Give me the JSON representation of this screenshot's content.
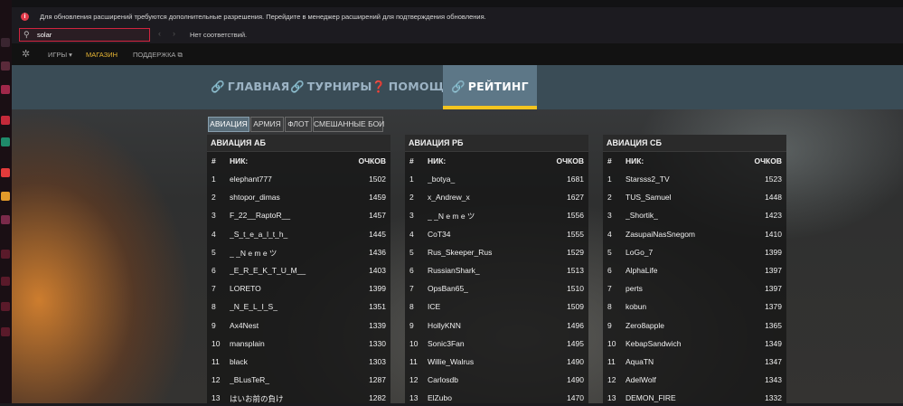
{
  "find": {
    "notice": "Для обновления расширений требуются дополнительные разрешения. Перейдите в менеджер расширений для подтверждения обновления.",
    "notice_icon": "info-icon",
    "query": "solar",
    "status": "Нет соответствий."
  },
  "topnav": {
    "games_label": "ИГРЫ ▾",
    "store_label": "МАГАЗИН",
    "support_label": "ПОДДЕРЖКА ⧉"
  },
  "menu": {
    "items": [
      {
        "label": "ГЛАВНАЯ",
        "icon": "link-icon"
      },
      {
        "label": "ТУРНИРЫ",
        "icon": "link-icon"
      },
      {
        "label": "ПОМОЩЬ",
        "icon": "question-circle-icon"
      },
      {
        "label": "РЕЙТИНГ",
        "icon": "link-icon"
      }
    ],
    "active_index": 3
  },
  "tabs": [
    "АВИАЦИЯ",
    "АРМИЯ",
    "ФЛОТ",
    "СМЕШАННЫЕ БОИ"
  ],
  "colors": {
    "accent": "#f3c51f",
    "header": "#3a4c56",
    "active": "#5d7787",
    "alert": "#d1243f"
  },
  "tables": [
    {
      "title": "АВИАЦИЯ АБ",
      "headers": [
        "#",
        "НИК:",
        "ОЧКОВ"
      ],
      "rows": [
        [
          "1",
          "elephant777",
          "1502"
        ],
        [
          "2",
          "shtopor_dimas",
          "1459"
        ],
        [
          "3",
          "F_22__RaptoR__",
          "1457"
        ],
        [
          "4",
          "_S_t_e_a_l_t_h_",
          "1445"
        ],
        [
          "5",
          "_ _N e m e ツ",
          "1436"
        ],
        [
          "6",
          "_E_R_E_K_T_U_M__",
          "1403"
        ],
        [
          "7",
          "LORETO",
          "1399"
        ],
        [
          "8",
          "_N_E_L_I_S_",
          "1351"
        ],
        [
          "9",
          "Ax4Nest",
          "1339"
        ],
        [
          "10",
          "mansplain",
          "1330"
        ],
        [
          "11",
          "black",
          "1303"
        ],
        [
          "12",
          "_BLusTeR_",
          "1287"
        ],
        [
          "13",
          "はいお前の負け",
          "1282"
        ]
      ]
    },
    {
      "title": "АВИАЦИЯ РБ",
      "headers": [
        "#",
        "НИК:",
        "ОЧКОВ"
      ],
      "rows": [
        [
          "1",
          "_botya_",
          "1681"
        ],
        [
          "2",
          "x_Andrew_x",
          "1627"
        ],
        [
          "3",
          "_ _N e m e ツ",
          "1556"
        ],
        [
          "4",
          "CoT34",
          "1555"
        ],
        [
          "5",
          "Rus_Skeeper_Rus",
          "1529"
        ],
        [
          "6",
          "RussianShark_",
          "1513"
        ],
        [
          "7",
          "OpsBan65_",
          "1510"
        ],
        [
          "8",
          "ICE",
          "1509"
        ],
        [
          "9",
          "HollyKNN",
          "1496"
        ],
        [
          "10",
          "Sonic3Fan",
          "1495"
        ],
        [
          "11",
          "Willie_Walrus",
          "1490"
        ],
        [
          "12",
          "Carlosdb",
          "1490"
        ],
        [
          "13",
          "ElZubo",
          "1470"
        ]
      ]
    },
    {
      "title": "АВИАЦИЯ СБ",
      "headers": [
        "#",
        "НИК:",
        "ОЧКОВ"
      ],
      "rows": [
        [
          "1",
          "Starsss2_TV",
          "1523"
        ],
        [
          "2",
          "TUS_Samuel",
          "1448"
        ],
        [
          "3",
          "_Shortik_",
          "1423"
        ],
        [
          "4",
          "ZasupaiNasSnegom",
          "1410"
        ],
        [
          "5",
          "LoGo_7",
          "1399"
        ],
        [
          "6",
          "AlphaLife",
          "1397"
        ],
        [
          "7",
          "perts",
          "1397"
        ],
        [
          "8",
          "kobun",
          "1379"
        ],
        [
          "9",
          "Zero8apple",
          "1365"
        ],
        [
          "10",
          "KebapSandwich",
          "1349"
        ],
        [
          "11",
          "AquaTN",
          "1347"
        ],
        [
          "12",
          "AdelWolf",
          "1343"
        ],
        [
          "13",
          "DEMON_FIRE",
          "1332"
        ]
      ]
    }
  ]
}
